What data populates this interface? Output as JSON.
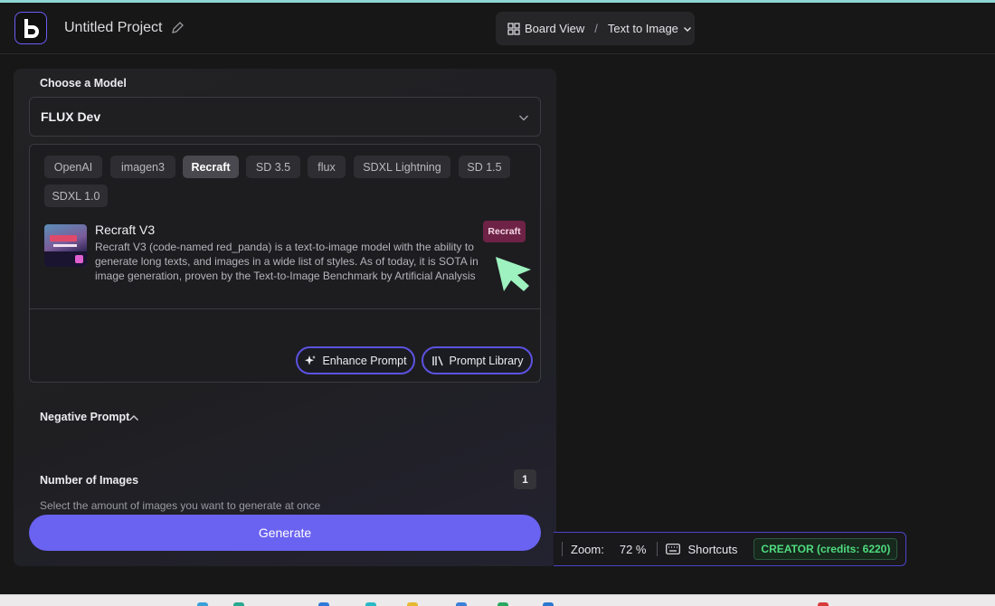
{
  "header": {
    "project_title": "Untitled Project",
    "breadcrumb": {
      "view": "Board View",
      "separator": "/",
      "mode": "Text to Image"
    }
  },
  "panel": {
    "model_label": "Choose a Model",
    "selected_model": "FLUX Dev",
    "tabs": [
      "OpenAI",
      "imagen3",
      "Recraft",
      "SD 3.5",
      "flux",
      "SDXL Lightning",
      "SD 1.5",
      "SDXL 1.0"
    ],
    "active_tab": "Recraft",
    "model_card": {
      "name": "Recraft V3",
      "description": "Recraft V3 (code-named red_panda) is a text-to-image model with the ability to generate long texts, and images in a wide list of styles. As of today, it is SOTA in image generation, proven by the Text-to-Image Benchmark by Artificial Analysis",
      "badge": "Recraft"
    },
    "enhance_prompt": "Enhance Prompt",
    "prompt_library": "Prompt Library",
    "negative_prompt_label": "Negative Prompt",
    "num_images_label": "Number of Images",
    "num_images_value": "1",
    "num_images_hint": "Select the amount of images you want to generate at once",
    "generate_label": "Generate"
  },
  "status_bar": {
    "zoom_label": "Zoom:",
    "zoom_value": "72 %",
    "shortcuts_label": "Shortcuts",
    "plan_badge": "CREATOR (credits: 6220)"
  },
  "colors": {
    "accent": "#6a62f0",
    "badge_bg": "#6e2246",
    "cursor": "#9ef2bf",
    "plan_green": "#4fdc7e"
  }
}
